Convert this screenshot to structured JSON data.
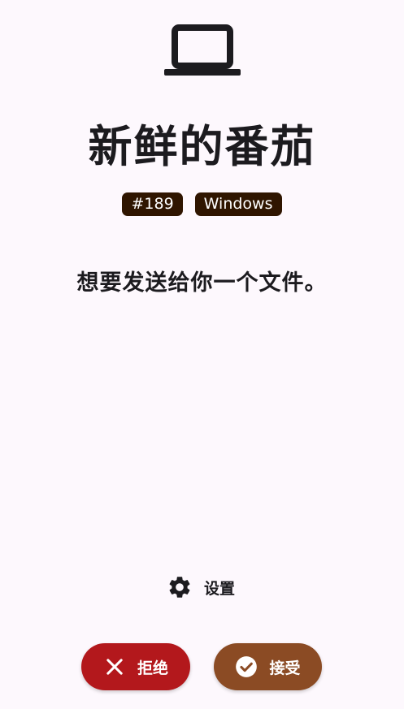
{
  "sender": {
    "device_icon": "laptop-icon",
    "name": "新鲜的番茄",
    "badges": [
      "#189",
      "Windows"
    ]
  },
  "message": "想要发送给你一个文件。",
  "settings": {
    "icon": "gear-icon",
    "label": "设置"
  },
  "actions": {
    "decline": {
      "label": "拒绝",
      "icon": "close-icon",
      "color": "#b3181c"
    },
    "accept": {
      "label": "接受",
      "icon": "check-circle-icon",
      "color": "#8b4b24"
    }
  }
}
